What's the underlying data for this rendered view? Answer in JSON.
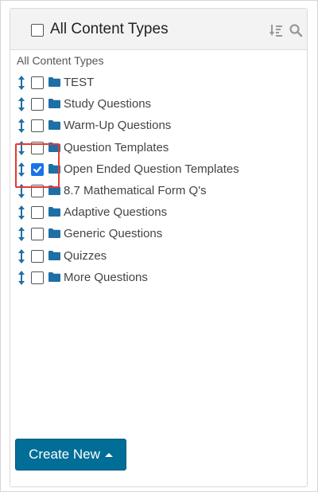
{
  "header": {
    "title": "All Content Types"
  },
  "group_label": "All Content Types",
  "items": [
    {
      "label": "TEST",
      "checked": false
    },
    {
      "label": "Study Questions",
      "checked": false
    },
    {
      "label": "Warm-Up Questions",
      "checked": false
    },
    {
      "label": "Question Templates",
      "checked": false
    },
    {
      "label": "Open Ended Question Templates",
      "checked": true
    },
    {
      "label": "8.7 Mathematical Form Q's",
      "checked": false
    },
    {
      "label": "Adaptive Questions",
      "checked": false
    },
    {
      "label": "Generic Questions",
      "checked": false
    },
    {
      "label": "Quizzes",
      "checked": false
    },
    {
      "label": "More Questions",
      "checked": false
    }
  ],
  "footer": {
    "create_label": "Create New"
  },
  "colors": {
    "accent": "#006e96",
    "folder": "#1d6fa5",
    "checkbox_checked": "#1a73e8",
    "highlight": "#e53935"
  },
  "icons": {
    "drag": "drag-handle-icon",
    "folder": "folder-icon",
    "sort": "sort-icon",
    "search": "search-icon"
  }
}
